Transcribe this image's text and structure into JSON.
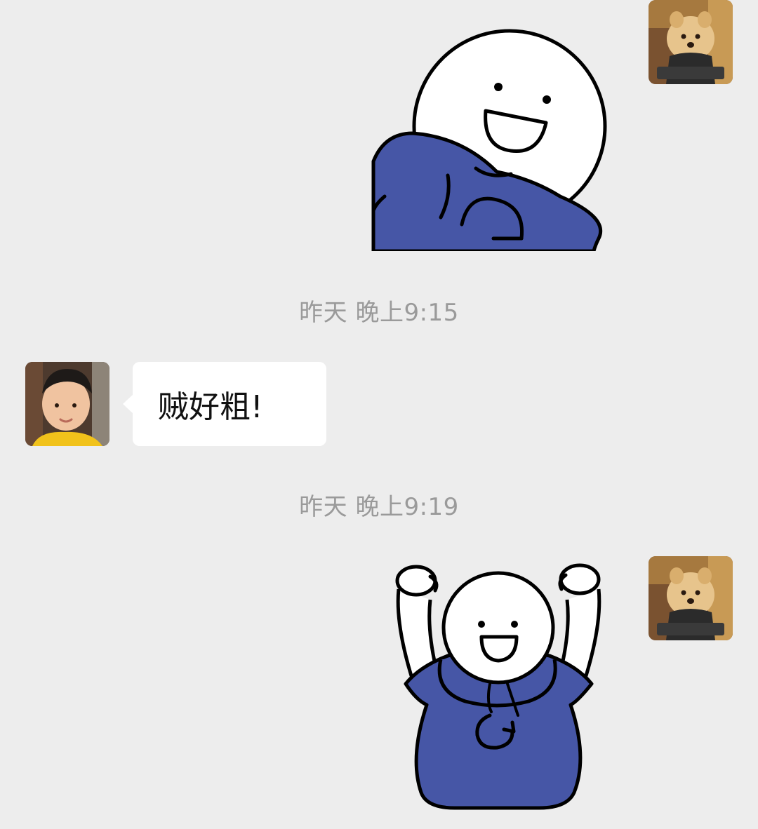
{
  "conversation": {
    "messages": [
      {
        "sender": "me",
        "kind": "sticker",
        "sticker_icon": "happy-blue-hoodie-bear-sticker"
      },
      {
        "kind": "timestamp",
        "text": "昨天 晚上9:15"
      },
      {
        "sender": "friend",
        "kind": "text",
        "text": "贼好粗!"
      },
      {
        "kind": "timestamp",
        "text": "昨天 晚上9:19"
      },
      {
        "sender": "me",
        "kind": "sticker",
        "sticker_icon": "cheering-blue-hoodie-sticker"
      }
    ]
  },
  "colors": {
    "background": "#ededed",
    "bubble": "#ffffff",
    "hoodie": "#4656a6",
    "timestamp_text": "#9a9a9a"
  }
}
